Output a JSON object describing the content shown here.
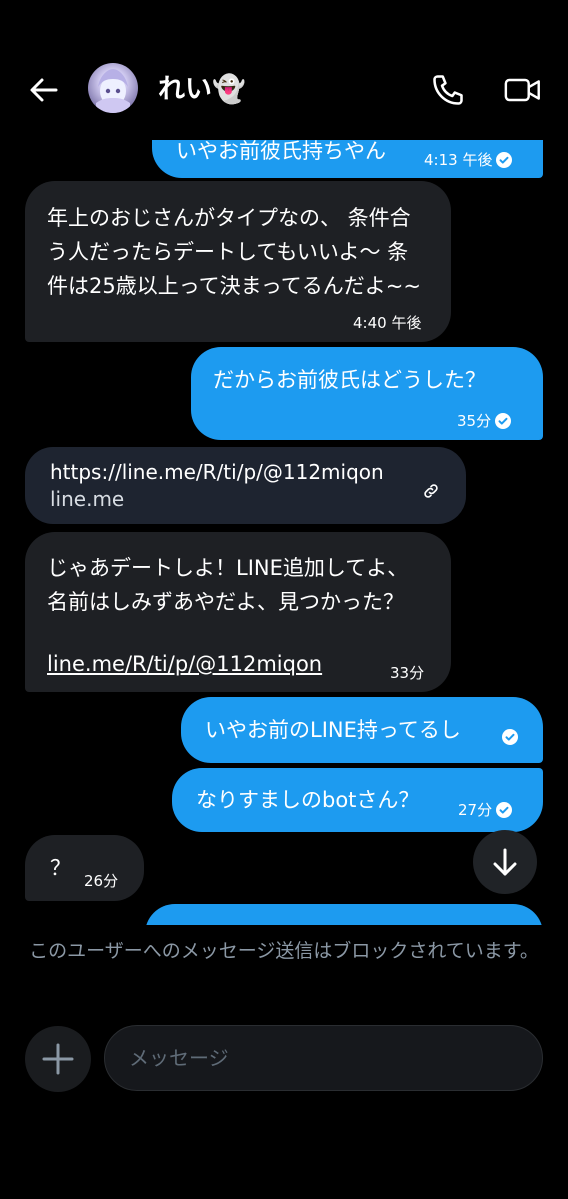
{
  "header": {
    "contact_name": "れい👻",
    "back_icon": "arrow-left-icon",
    "call_icon": "phone-icon",
    "video_icon": "video-camera-icon"
  },
  "messages": [
    {
      "direction": "out",
      "text": "いやお前彼氏持ちやん",
      "time": "4:13 午後",
      "read": true
    },
    {
      "direction": "in",
      "text": "年上のおじさんがタイプなの、 条件合う人だったらデートしてもいいよ～ 条件は25歳以上って決まってるんだよ~~",
      "time": "4:40 午後"
    },
    {
      "direction": "out",
      "text": "だからお前彼氏はどうした？",
      "time": "35分",
      "read": true
    },
    {
      "direction": "in",
      "type": "link-card",
      "url": "https://line.me/R/ti/p/@112miqon",
      "domain": "line.me"
    },
    {
      "direction": "in",
      "text": "じゃあデートしよ！LINE追加してよ、名前はしみずあやだよ、見つかった？",
      "link": "line.me/R/ti/p/@112miqon",
      "time": "33分"
    },
    {
      "direction": "out",
      "text": "いやお前のLINE持ってるし",
      "read": true
    },
    {
      "direction": "out",
      "text": "なりすましのbotさん？",
      "time": "27分",
      "read": true
    },
    {
      "direction": "in",
      "text": "？",
      "time": "26分"
    }
  ],
  "footer": {
    "blocked_notice": "このユーザーへのメッセージ送信はブロックされています。",
    "input_placeholder": "メッセージ"
  },
  "colors": {
    "outgoing": "#1d9bf0",
    "incoming": "#1e2024",
    "background": "#000000",
    "muted_text": "#8b98a5"
  }
}
